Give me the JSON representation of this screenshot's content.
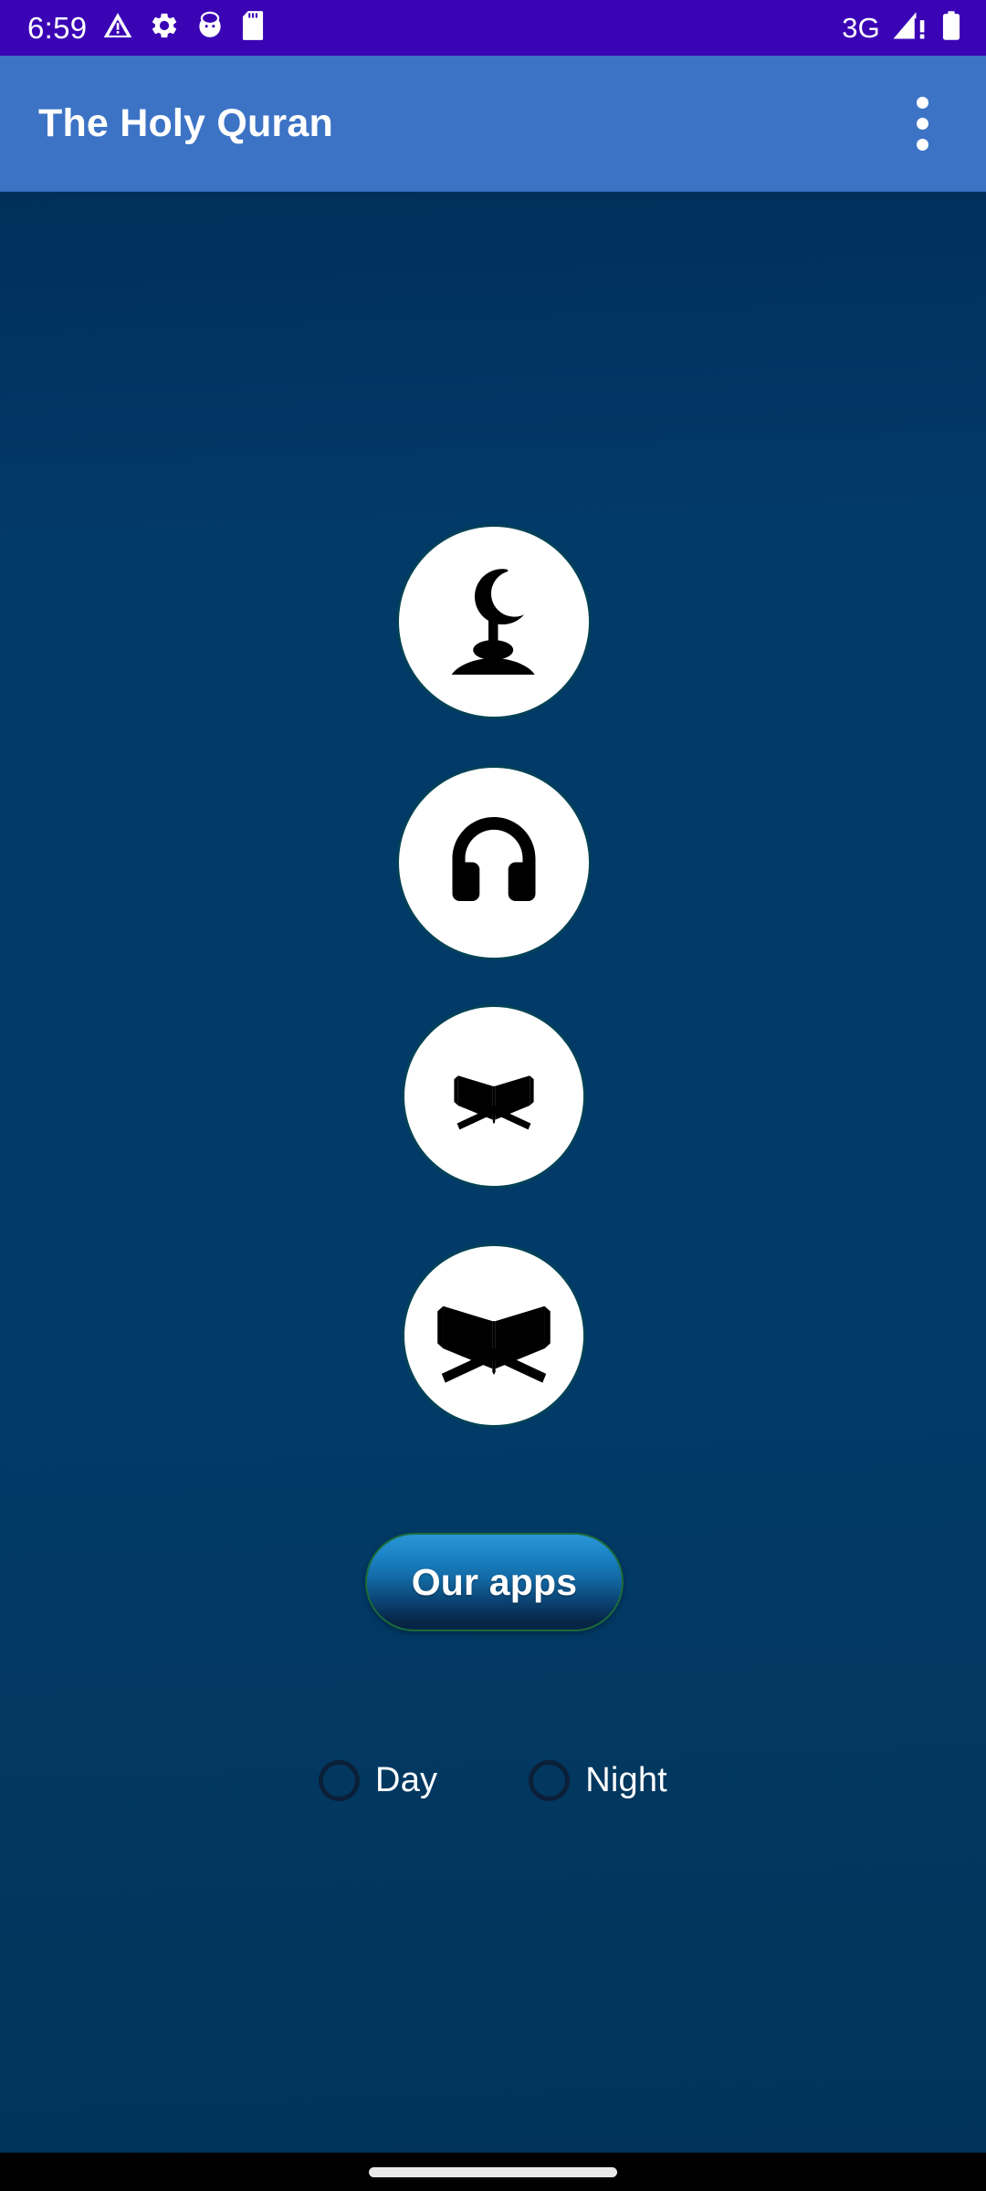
{
  "status_bar": {
    "time": "6:59",
    "network_type": "3G",
    "left_icons": [
      "warning-triangle-icon",
      "gear-icon",
      "android-debug-icon",
      "sd-card-icon"
    ],
    "right_icons": [
      "signal-bars-warning-icon",
      "battery-full-icon"
    ],
    "background_color": "#3A04B5"
  },
  "app_bar": {
    "title": "The Holy Quran",
    "overflow_menu": "overflow-menu-icon",
    "background_color": "#3C73C5",
    "text_color": "#FFFFFF"
  },
  "content": {
    "background_color": "#023A68",
    "circle_buttons": [
      {
        "name": "mosque-crescent-button",
        "icon": "mosque-crescent-icon",
        "label": ""
      },
      {
        "name": "audio-button",
        "icon": "headphones-icon",
        "label": ""
      },
      {
        "name": "quran-read-button",
        "icon": "quran-rehal-small-icon",
        "label": ""
      },
      {
        "name": "quran-browse-button",
        "icon": "quran-rehal-large-icon",
        "label": ""
      }
    ],
    "our_apps_button": {
      "label": "Our apps",
      "gradient_top": "#2A96D6",
      "gradient_bottom": "#062243",
      "border_color": "#1A6B3C"
    },
    "theme_options": [
      {
        "label": "Day",
        "selected": false
      },
      {
        "label": "Night",
        "selected": false
      }
    ]
  },
  "nav_bar": {
    "gesture_handle": "home-gesture-pill",
    "background_color": "#000000"
  }
}
